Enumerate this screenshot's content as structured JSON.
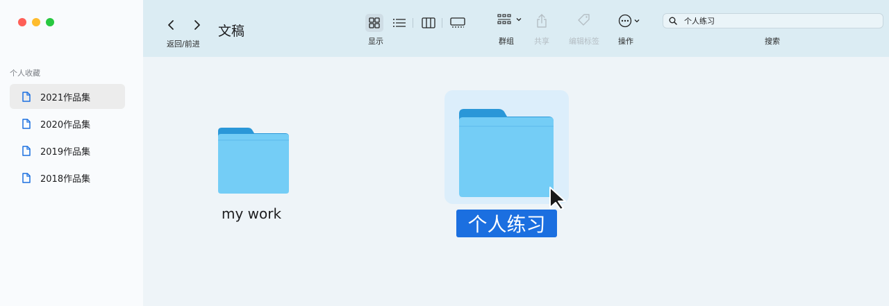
{
  "sidebar": {
    "section_title": "个人收藏",
    "items": [
      {
        "label": "2021作品集",
        "active": true
      },
      {
        "label": "2020作品集",
        "active": false
      },
      {
        "label": "2019作品集",
        "active": false
      },
      {
        "label": "2018作品集",
        "active": false
      }
    ]
  },
  "toolbar": {
    "nav_label": "返回/前进",
    "title": "文稿",
    "view_label": "显示",
    "group_label": "群组",
    "share_label": "共享",
    "tags_label": "编辑标签",
    "action_label": "操作",
    "search_value": "个人练习",
    "search_label": "搜索"
  },
  "content": {
    "folders": [
      {
        "name": "my work",
        "selected": false
      },
      {
        "name": "个人练习",
        "selected": true
      }
    ]
  },
  "colors": {
    "accent": "#1b6fe0",
    "toolbar_bg": "#dbecf3",
    "folder_light": "#74cdf6",
    "folder_dark": "#2a97d8"
  }
}
